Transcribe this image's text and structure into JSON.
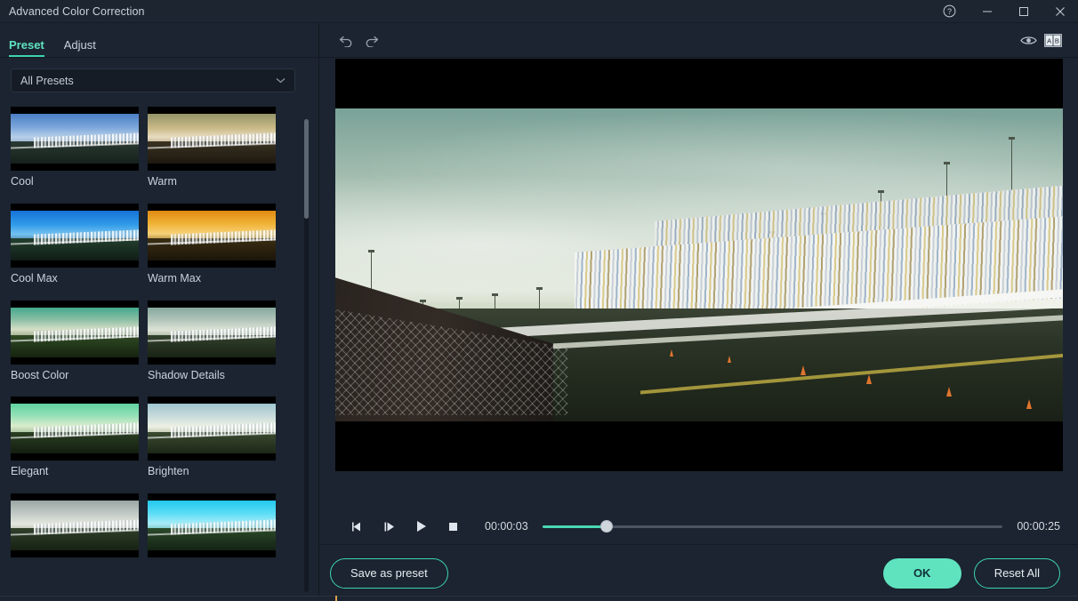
{
  "window": {
    "title": "Advanced Color Correction",
    "controls": [
      {
        "name": "help-button",
        "label": "?"
      },
      {
        "name": "minimize-button",
        "label": "—"
      },
      {
        "name": "maximize-button",
        "label": "□"
      },
      {
        "name": "close-button",
        "label": "✕"
      }
    ]
  },
  "left_panel": {
    "tabs": [
      {
        "label": "Preset",
        "active": true
      },
      {
        "label": "Adjust",
        "active": false
      }
    ],
    "filter": {
      "selected": "All Presets",
      "options": [
        "All Presets"
      ]
    },
    "presets": [
      {
        "label": "Cool",
        "sky": "linear-gradient(180deg,#4a7fc4 0%,#7fa8dc 45%,#b7cfe8 75%,#8fa7bd 100%)",
        "ground": "linear-gradient(180deg,#2a3a33 0%,#16201c 100%)"
      },
      {
        "label": "Warm",
        "sky": "linear-gradient(180deg,#94946a 0%,#c9b986 45%,#e8dcc0 75%,#b3a485 100%)",
        "ground": "linear-gradient(180deg,#3a3322 0%,#1d1810 100%)"
      },
      {
        "label": "Cool Max",
        "sky": "linear-gradient(180deg,#1572d6 0%,#2f9ae8 45%,#74c2f0 78%,#4e86a8 100%)",
        "ground": "linear-gradient(180deg,#24402f 0%,#0f1c16 100%)"
      },
      {
        "label": "Warm Max",
        "sky": "linear-gradient(180deg,#e08a12 0%,#f0b234 42%,#f7d178 76%,#a8863a 100%)",
        "ground": "linear-gradient(180deg,#3a2e12 0%,#1b150a 100%)"
      },
      {
        "label": "Boost Color",
        "sky": "linear-gradient(180deg,#44a98c 0%,#86bda3 38%,#d6dfc6 72%,#97a384 100%)",
        "ground": "linear-gradient(180deg,#2f4a24 0%,#16230f 100%)"
      },
      {
        "label": "Shadow Details",
        "sky": "linear-gradient(180deg,#86a89e 0%,#b1c4ba 40%,#dde3d6 74%,#a3ae9b 100%)",
        "ground": "linear-gradient(180deg,#32412c 0%,#1a2316 100%)"
      },
      {
        "label": "Elegant",
        "sky": "linear-gradient(180deg,#5fd3a0 0%,#94e0b6 38%,#d9eccc 72%,#9eb593 100%)",
        "ground": "linear-gradient(180deg,#2a3f22 0%,#141e10 100%)"
      },
      {
        "label": "Brighten",
        "sky": "linear-gradient(180deg,#9fc6cd 0%,#c8dbdb 40%,#edf1e3 74%,#b4bfa7 100%)",
        "ground": "linear-gradient(180deg,#3a4b30 0%,#1d2717 100%)"
      },
      {
        "label": "",
        "sky": "linear-gradient(180deg,#9aa6a4 0%,#c2cac6 42%,#e4e8df 76%,#aab2a2 100%)",
        "ground": "linear-gradient(180deg,#30402a 0%,#172113 100%)"
      },
      {
        "label": "",
        "sky": "linear-gradient(180deg,#23c8ef 0%,#59dcf5 40%,#a8ecf7 74%,#6fb7b0 100%)",
        "ground": "linear-gradient(180deg,#2c4a2a 0%,#142314 100%)"
      }
    ],
    "scrollbar": {
      "name": "preset-scrollbar"
    }
  },
  "toolbar": {
    "undo": "undo-icon",
    "redo": "redo-icon",
    "preview": "eye-icon",
    "compare": "ab-compare-icon"
  },
  "player": {
    "buttons": [
      {
        "name": "previous-frame-button",
        "label": "previous-frame-icon"
      },
      {
        "name": "next-frame-button",
        "label": "next-frame-icon"
      },
      {
        "name": "play-button",
        "label": "play-icon"
      },
      {
        "name": "stop-button",
        "label": "stop-icon"
      }
    ],
    "current_time": "00:00:03",
    "total_time": "00:00:25",
    "progress_percent": 14
  },
  "footer": {
    "save_as_preset": "Save as preset",
    "ok": "OK",
    "reset_all": "Reset All"
  },
  "colors": {
    "accent": "#3fd3b0",
    "accent_fill": "#5fe3be",
    "panel_bg": "#1b2430",
    "titlebar_bg": "#1d2531",
    "text": "#c9d2dc",
    "marker": "#e0a04a"
  }
}
